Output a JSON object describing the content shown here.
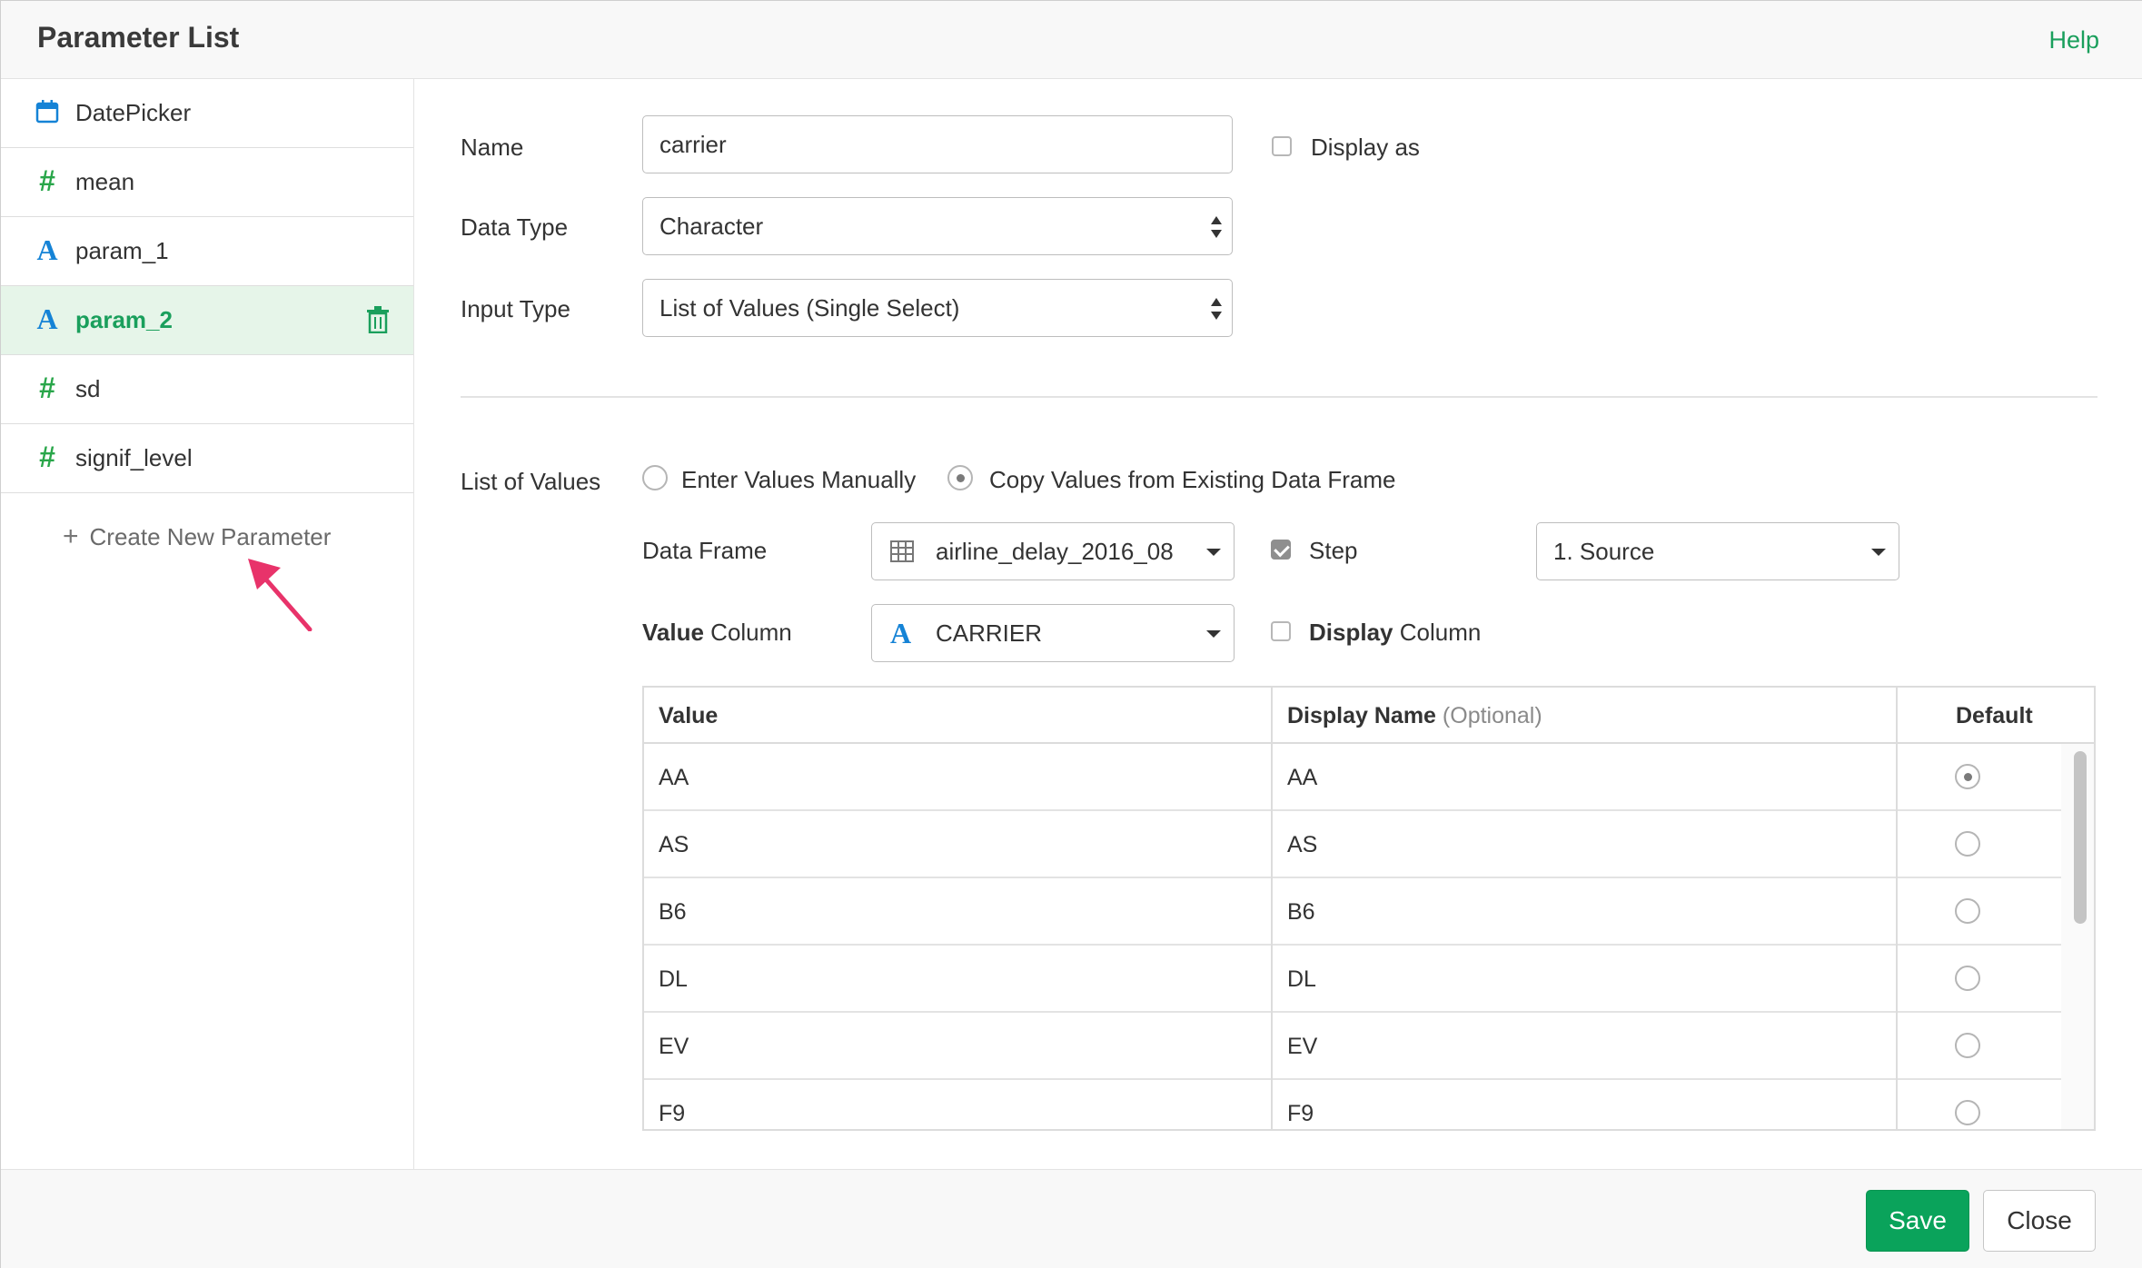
{
  "header": {
    "title": "Parameter List",
    "help": "Help"
  },
  "sidebar": {
    "items": [
      {
        "label": "DatePicker",
        "icon": "calendar-icon"
      },
      {
        "label": "mean",
        "icon": "#"
      },
      {
        "label": "param_1",
        "icon": "A"
      },
      {
        "label": "param_2",
        "icon": "A",
        "active": true
      },
      {
        "label": "sd",
        "icon": "#"
      },
      {
        "label": "signif_level",
        "icon": "#"
      }
    ],
    "create_new": "Create New Parameter"
  },
  "form": {
    "name_label": "Name",
    "name_value": "carrier",
    "display_as_label": "Display as",
    "data_type_label": "Data Type",
    "data_type_value": "Character",
    "input_type_label": "Input Type",
    "input_type_value": "List of Values (Single Select)",
    "list_of_values_label": "List of Values",
    "enter_manually_label": "Enter Values Manually",
    "copy_values_label": "Copy Values from Existing Data Frame",
    "data_frame_label": "Data Frame",
    "data_frame_value": "airline_delay_2016_08",
    "step_label": "Step",
    "step_value": "1. Source",
    "value_column_bold": "Value",
    "value_column_rest": " Column",
    "value_column_value": "CARRIER",
    "display_column_bold": "Display",
    "display_column_rest": " Column"
  },
  "table": {
    "headers": {
      "value": "Value",
      "display": "Display Name",
      "optional": "(Optional)",
      "default": "Default"
    },
    "rows": [
      {
        "value": "AA",
        "display": "AA"
      },
      {
        "value": "AS",
        "display": "AS"
      },
      {
        "value": "B6",
        "display": "B6"
      },
      {
        "value": "DL",
        "display": "DL"
      },
      {
        "value": "EV",
        "display": "EV"
      },
      {
        "value": "F9",
        "display": "F9"
      }
    ]
  },
  "footer": {
    "save": "Save",
    "close": "Close"
  },
  "colors": {
    "accent": "#1a9f5c",
    "save": "#0aa35b",
    "arrow": "#e8336a",
    "type_char": "#1583d6",
    "type_num": "#29a64a"
  }
}
